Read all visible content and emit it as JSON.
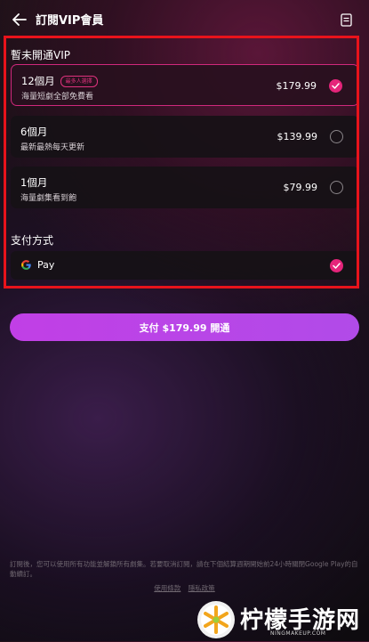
{
  "header": {
    "title": "訂閱VIP會員"
  },
  "vip_section": {
    "label": "暫未開通VIP",
    "plans": [
      {
        "name": "12個月",
        "badge": "最多人選擇",
        "desc": "海量短劇全部免費看",
        "price": "$179.99",
        "selected": true
      },
      {
        "name": "6個月",
        "desc": "最新最熱每天更新",
        "price": "$139.99",
        "selected": false
      },
      {
        "name": "1個月",
        "desc": "海量劇集看到飽",
        "price": "$79.99",
        "selected": false
      }
    ]
  },
  "payment": {
    "label": "支付方式",
    "method": "Pay",
    "selected": true
  },
  "pay_button": {
    "label": "支付 $179.99 開通"
  },
  "footer": {
    "note": "訂閱後，您可以使用所有功能並解鎖所有劇集。若要取消訂閱，請在下個結算週期開始前24小時關閉Google Play的自動續訂。",
    "terms": "使用條款",
    "privacy": "隱私政策"
  },
  "watermark": {
    "text": "柠檬手游网",
    "url": "NINGMAKEUP.COM"
  },
  "colors": {
    "accent": "#e5247a",
    "button": "#c13fe6",
    "highlight": "#e8131b"
  }
}
